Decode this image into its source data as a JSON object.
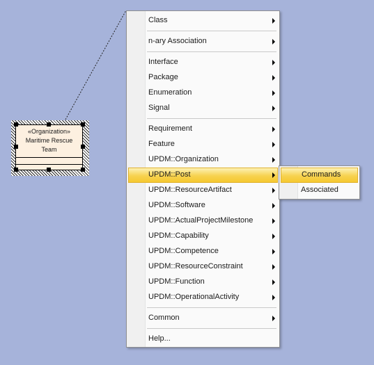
{
  "diagram": {
    "element": {
      "stereotype": "«Organization»",
      "name_line1": "Maritime Rescue",
      "name_line2": "Team"
    }
  },
  "context_menu": {
    "items": [
      {
        "label": "Class",
        "submenu": true
      },
      {
        "label": "n-ary Association",
        "submenu": true
      },
      {
        "label": "Interface",
        "submenu": true
      },
      {
        "label": "Package",
        "submenu": true
      },
      {
        "label": "Enumeration",
        "submenu": true
      },
      {
        "label": "Signal",
        "submenu": true
      },
      {
        "label": "Requirement",
        "submenu": true
      },
      {
        "label": "Feature",
        "submenu": true
      },
      {
        "label": "UPDM::Organization",
        "submenu": true
      },
      {
        "label": "UPDM::Post",
        "submenu": true,
        "highlighted": true
      },
      {
        "label": "UPDM::ResourceArtifact",
        "submenu": true
      },
      {
        "label": "UPDM::Software",
        "submenu": true
      },
      {
        "label": "UPDM::ActualProjectMilestone",
        "submenu": true
      },
      {
        "label": "UPDM::Capability",
        "submenu": true
      },
      {
        "label": "UPDM::Competence",
        "submenu": true
      },
      {
        "label": "UPDM::ResourceConstraint",
        "submenu": true
      },
      {
        "label": "UPDM::Function",
        "submenu": true
      },
      {
        "label": "UPDM::OperationalActivity",
        "submenu": true
      },
      {
        "label": "Common",
        "submenu": true
      },
      {
        "label": "Help...",
        "submenu": false
      }
    ]
  },
  "submenu": {
    "items": [
      {
        "label": "Commands",
        "highlighted": true
      },
      {
        "label": "Associated",
        "highlighted": false
      }
    ]
  },
  "colors": {
    "canvas": "#a6b3da",
    "element_fill": "#fdf0e0",
    "highlight": "#f7d24f"
  }
}
